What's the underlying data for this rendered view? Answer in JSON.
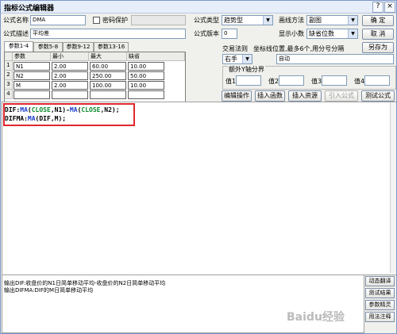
{
  "window": {
    "title": "指标公式编辑器",
    "help_label": "?",
    "close_label": "×"
  },
  "form": {
    "name_label": "公式名称",
    "name_value": "DMA",
    "password_label": "密码保护",
    "desc_label": "公式描述",
    "desc_value": "平均差",
    "type_label": "公式类型",
    "type_value": "趋势型",
    "draw_label": "画线方法",
    "draw_value": "副图",
    "version_label": "公式版本",
    "version_value": "0",
    "decimals_label": "显示小数",
    "decimals_value": "缺省位数",
    "trade_label": "交易法则",
    "trade_value": "右手",
    "coord_label": "坐标线位置,最多6个,用分号分隔",
    "coord_value": "自动",
    "axis_group_label": "额外Y轴分界",
    "axis_values": [
      {
        "label": "值1",
        "value": ""
      },
      {
        "label": "值2",
        "value": ""
      },
      {
        "label": "值3",
        "value": ""
      },
      {
        "label": "值4",
        "value": ""
      }
    ]
  },
  "buttons": {
    "ok": "确 定",
    "cancel": "取 消",
    "save_as": "另存为",
    "edit_ops": "编辑操作",
    "insert_func": "插入函数",
    "insert_res": "插入资源",
    "import_formula": "引入公式",
    "test_formula": "测试公式"
  },
  "param_tabs": [
    "参数1-4",
    "参数5-8",
    "参数9-12",
    "参数13-16"
  ],
  "param_table": {
    "headers": [
      "参数",
      "最小",
      "最大",
      "缺省"
    ],
    "rows": [
      {
        "idx": "1",
        "name": "N1",
        "min": "2.00",
        "max": "60.00",
        "def": "10.00"
      },
      {
        "idx": "2",
        "name": "N2",
        "min": "2.00",
        "max": "250.00",
        "def": "50.00"
      },
      {
        "idx": "3",
        "name": "M",
        "min": "2.00",
        "max": "100.00",
        "def": "10.00"
      },
      {
        "idx": "4",
        "name": "",
        "min": "",
        "max": "",
        "def": ""
      }
    ]
  },
  "code": {
    "line1": [
      {
        "t": "DIF:",
        "c": "plain"
      },
      {
        "t": "MA",
        "c": "fn"
      },
      {
        "t": "(",
        "c": "plain"
      },
      {
        "t": "CLOSE",
        "c": "var"
      },
      {
        "t": ",N1)-",
        "c": "plain"
      },
      {
        "t": "MA",
        "c": "fn"
      },
      {
        "t": "(",
        "c": "plain"
      },
      {
        "t": "CLOSE",
        "c": "var"
      },
      {
        "t": ",N2);",
        "c": "plain"
      }
    ],
    "line2": [
      {
        "t": "DIFMA:",
        "c": "plain"
      },
      {
        "t": "MA",
        "c": "fn"
      },
      {
        "t": "(DIF,M);",
        "c": "plain"
      }
    ]
  },
  "output": {
    "line1": "输出DIF:收盘价的N1日简单移动平均-收盘价的N2日简单移动平均",
    "line2": "输出DIFMA:DIF的M日简单移动平均"
  },
  "side_buttons": [
    "动态翻译",
    "测试结果",
    "参数精灵",
    "用法注释"
  ],
  "watermark": "Baidu经验",
  "colors": {
    "highlight_box": "#e0282e",
    "function": "#1a3cc8",
    "variable": "#0b8a2a"
  }
}
